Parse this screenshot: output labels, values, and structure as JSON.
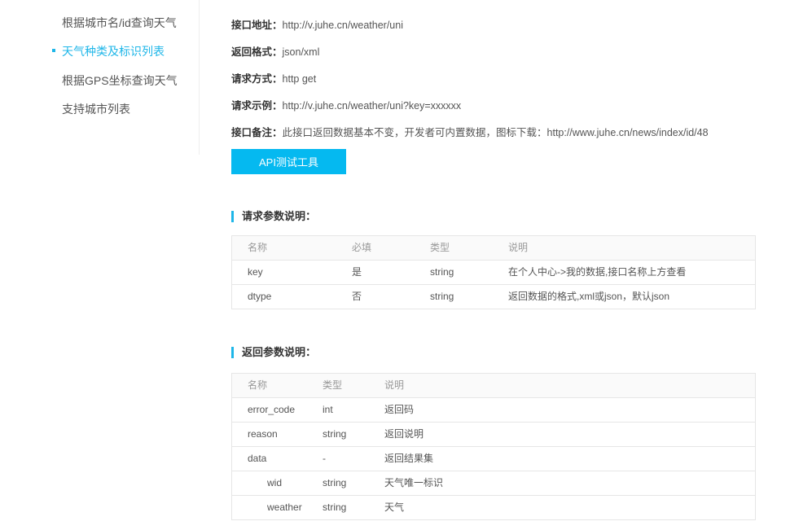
{
  "sidebar": {
    "items": [
      {
        "label": "根据城市名/id查询天气",
        "active": false
      },
      {
        "label": "天气种类及标识列表",
        "active": true
      },
      {
        "label": "根据GPS坐标查询天气",
        "active": false
      },
      {
        "label": "支持城市列表",
        "active": false
      }
    ]
  },
  "info": {
    "endpoint_label": "接口地址：",
    "endpoint_value": "http://v.juhe.cn/weather/uni",
    "format_label": "返回格式：",
    "format_value": "json/xml",
    "method_label": "请求方式：",
    "method_value": "http get",
    "example_label": "请求示例：",
    "example_value": "http://v.juhe.cn/weather/uni?key=xxxxxx",
    "remark_label": "接口备注：",
    "remark_value": "此接口返回数据基本不变，开发者可内置数据，图标下载：http://www.juhe.cn/news/index/id/48"
  },
  "api_button": "API测试工具",
  "request_params": {
    "title": "请求参数说明：",
    "headers": [
      "名称",
      "必填",
      "类型",
      "说明"
    ],
    "rows": [
      [
        "key",
        "是",
        "string",
        "在个人中心->我的数据,接口名称上方查看"
      ],
      [
        "dtype",
        "否",
        "string",
        "返回数据的格式,xml或json，默认json"
      ]
    ]
  },
  "response_params": {
    "title": "返回参数说明：",
    "headers": [
      "名称",
      "类型",
      "说明"
    ],
    "rows": [
      [
        "error_code",
        "int",
        "返回码"
      ],
      [
        "reason",
        "string",
        "返回说明"
      ],
      [
        "data",
        "-",
        "返回结果集"
      ],
      [
        "wid",
        "string",
        "天气唯一标识"
      ],
      [
        "weather",
        "string",
        "天气"
      ]
    ]
  },
  "colors": {
    "accent": "#1eb6e8",
    "button": "#05b9f0"
  }
}
